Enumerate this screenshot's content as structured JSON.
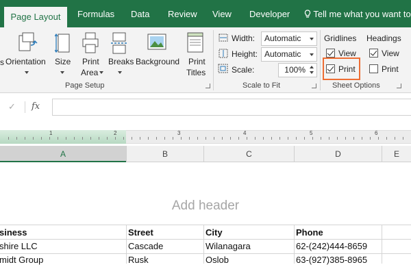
{
  "tabs": {
    "active": "Page Layout",
    "items": [
      "Formulas",
      "Data",
      "Review",
      "View",
      "Developer"
    ],
    "tell_me": "Tell me what you want to"
  },
  "page_setup": {
    "orientation": "Orientation",
    "size": "Size",
    "print_area_1": "Print",
    "print_area_2": "Area",
    "breaks": "Breaks",
    "background": "Background",
    "print_titles_1": "Print",
    "print_titles_2": "Titles",
    "group_label": "Page Setup",
    "cut_prefix": "s"
  },
  "scale_to_fit": {
    "width_label": "Width:",
    "width_value": "Automatic",
    "height_label": "Height:",
    "height_value": "Automatic",
    "scale_label": "Scale:",
    "scale_value": "100%",
    "group_label": "Scale to Fit"
  },
  "sheet_options": {
    "gridlines": "Gridlines",
    "headings": "Headings",
    "view": "View",
    "print": "Print",
    "gridlines_view": true,
    "gridlines_print": true,
    "headings_view": true,
    "headings_print": false,
    "group_label": "Sheet Options"
  },
  "formula_bar": {
    "cancel": "✓",
    "fx": "fx",
    "value": ""
  },
  "ruler": {
    "marks": [
      "1",
      "2",
      "3",
      "4",
      "5",
      "6"
    ]
  },
  "columns": [
    "A",
    "B",
    "C",
    "D",
    "E"
  ],
  "sheet": {
    "add_header": "Add header",
    "table_headers": [
      "siness",
      "Street",
      "City",
      "Phone"
    ],
    "rows": [
      [
        "shire LLC",
        "Cascade",
        "Wilanagara",
        "62-(242)444-8659"
      ],
      [
        "midt Group",
        "Rusk",
        "Oslob",
        "63-(927)385-8965"
      ]
    ]
  },
  "colors": {
    "accent": "#217346",
    "highlight": "#ed6d33"
  }
}
